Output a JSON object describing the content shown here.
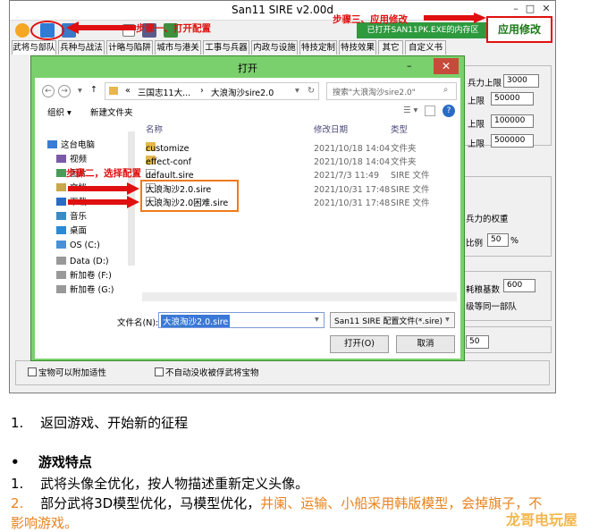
{
  "app": {
    "title": "San11 SIRE v2.00d",
    "status_button": "已打开SAN11PK.EXE的内存区",
    "apply_button": "应用修改"
  },
  "annotations": {
    "step1": "步骤一、打开配置",
    "step2": "步骤二，选择配置",
    "step3": "步骤三、应用修改"
  },
  "tabs": [
    "武将与部队",
    "兵种与战法",
    "计略与陷阱",
    "城市与港关",
    "工事与兵器",
    "内政与设施",
    "特技定制",
    "特技效果",
    "其它",
    "自定义书"
  ],
  "right_fields": [
    {
      "label": "兵力上限",
      "value": "3000"
    },
    {
      "label": "上限",
      "value": "50000"
    },
    {
      "label": "上限",
      "value": "100000"
    },
    {
      "label": "上限",
      "value": "500000"
    }
  ],
  "right_misc": {
    "weight_label": "兵力的权重",
    "ratio_label": "比例",
    "ratio_value": "50",
    "ratio_unit": "%",
    "food_label": "耗粮基数",
    "food_value": "600",
    "same_unit": "级等同一部队",
    "bottom_value": "50"
  },
  "checkboxes": {
    "left": "宝物可以附加适性",
    "right": "不自动没收被俘武将宝物"
  },
  "dialog": {
    "title": "打开",
    "address": [
      "三国志11大...",
      "大浪淘沙sire2.0"
    ],
    "search_placeholder": "搜索\"大浪淘沙sire2.0\"",
    "organize": "组织",
    "new_folder": "新建文件夹",
    "col_name": "名称",
    "col_date": "修改日期",
    "col_type": "类型",
    "tree": [
      "这台电脑",
      "视频",
      "图片",
      "文档",
      "下载",
      "音乐",
      "桌面",
      "OS (C:)",
      "Data (D:)",
      "新加卷 (F:)",
      "新加卷 (G:)"
    ],
    "files": [
      {
        "name": "customize",
        "date": "2021/10/18 14:04",
        "type": "文件夹"
      },
      {
        "name": "effect-conf",
        "date": "2021/10/18 14:04",
        "type": "文件夹"
      },
      {
        "name": "default.sire",
        "date": "2021/7/3 11:49",
        "type": "SIRE 文件"
      },
      {
        "name": "大浪淘沙2.0.sire",
        "date": "2021/10/31 17:48",
        "type": "SIRE 文件"
      },
      {
        "name": "大浪淘沙2.0困难.sire",
        "date": "2021/10/31 17:48",
        "type": "SIRE 文件"
      }
    ],
    "filename_label": "文件名(N):",
    "filename_value": "大浪淘沙2.0.sire",
    "filter_value": "San11 SIRE 配置文件(*.sire)",
    "open_button": "打开(O)",
    "cancel_button": "取消"
  },
  "doc": {
    "item1_num": "1.",
    "item1": "返回游戏、开始新的征程",
    "bullet": "•",
    "heading": "游戏特点",
    "f1_num": "1.",
    "f1": "武将头像全优化，按人物描述重新定义头像。",
    "f2_num": "2.",
    "f2_a": "部分武将3D模型优化，马模型优化，",
    "f2_b": "井阑、运输、小船采用韩版模型，会掉旗子，不",
    "f2_c": "影响游戏。",
    "watermark": "龙哥电玩屋"
  },
  "colors": {
    "annotation": "#e01010",
    "apply_border": "#e01010",
    "status_bg": "#2e9a3e",
    "dialog_frame": "#7ad06c",
    "highlight": "#f07a1a",
    "orange_text": "#e8821c"
  }
}
